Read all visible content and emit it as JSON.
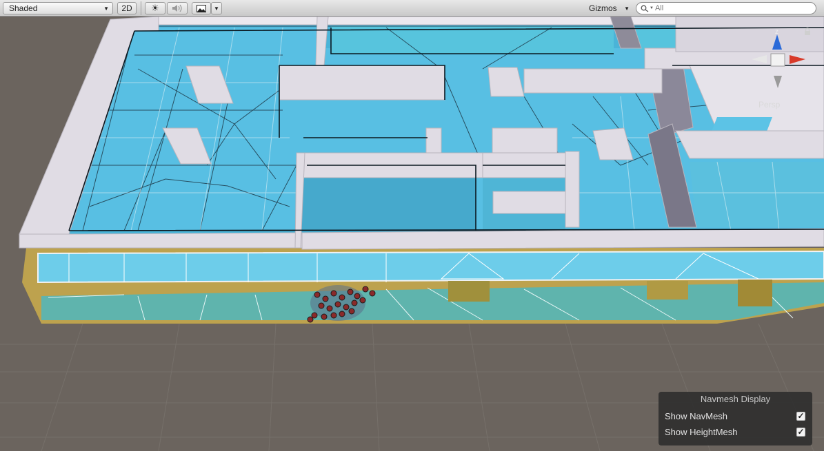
{
  "toolbar": {
    "shading_mode": "Shaded",
    "btn_2d": "2D",
    "gizmos_label": "Gizmos",
    "search_placeholder": "All"
  },
  "gizmo": {
    "axis_z": "z",
    "projection": "Persp"
  },
  "navmesh_panel": {
    "title": "Navmesh Display",
    "show_navmesh_label": "Show NavMesh",
    "show_navmesh_checked": true,
    "show_heightmesh_label": "Show HeightMesh",
    "show_heightmesh_checked": true
  },
  "colors": {
    "navmesh": "#5cc3e6",
    "wall": "#e0dce4",
    "floor_band": "#bda24e",
    "ground": "#6b645e",
    "agent": "#8a2a2a"
  }
}
